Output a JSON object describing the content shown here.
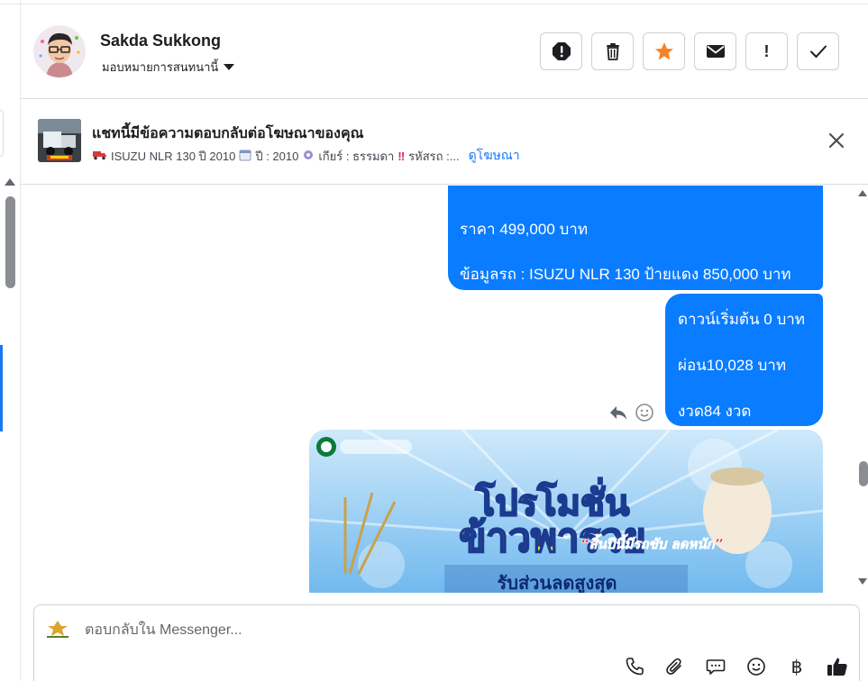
{
  "contact": {
    "name": "Sakda Sukkong",
    "assign_label": "มอบหมายการสนทนานี้"
  },
  "header_actions": [
    {
      "name": "spam",
      "icon": "octagon-exclamation-icon"
    },
    {
      "name": "delete",
      "icon": "trash-icon"
    },
    {
      "name": "star",
      "icon": "star-icon"
    },
    {
      "name": "mark-unread",
      "icon": "envelope-icon"
    },
    {
      "name": "follow-up",
      "icon": "exclamation-icon",
      "text": "!"
    },
    {
      "name": "mark-done",
      "icon": "check-icon"
    }
  ],
  "ad_banner": {
    "title": "แชทนี้มีข้อความตอบกลับต่อโฆษณาของคุณ",
    "desc_1": "ISUZU NLR 130 ปี 2010",
    "desc_2": "ปี : 2010",
    "desc_3": "เกียร์ : ธรรมดา",
    "desc_4": "รหัสรถ :...",
    "link": "ดูโฆษณา"
  },
  "messages": {
    "bubble1": {
      "line1": "ราคา 499,000 บาท",
      "line2": "ข้อมูลรถ : ISUZU NLR 130 ป้ายแดง 850,000 บาท"
    },
    "bubble2": {
      "line1": "ดาวน์เริ่มต้น 0 บาท",
      "line2": "ผ่อน10,028 บาท",
      "line3": "งวด84 งวด"
    },
    "promo_image": {
      "headline": "โปรโมชั่น",
      "main": "ข้าวพารวย",
      "tagline": "“สิ้นปีนี้มีรถขับ ลดหนัก”",
      "footer": "รับส่วนลดสูงสุด"
    }
  },
  "composer": {
    "placeholder": "ตอบกลับใน Messenger..."
  },
  "colors": {
    "bubble": "#0a7cff",
    "accent": "#1877f2",
    "star": "#f5822a"
  }
}
